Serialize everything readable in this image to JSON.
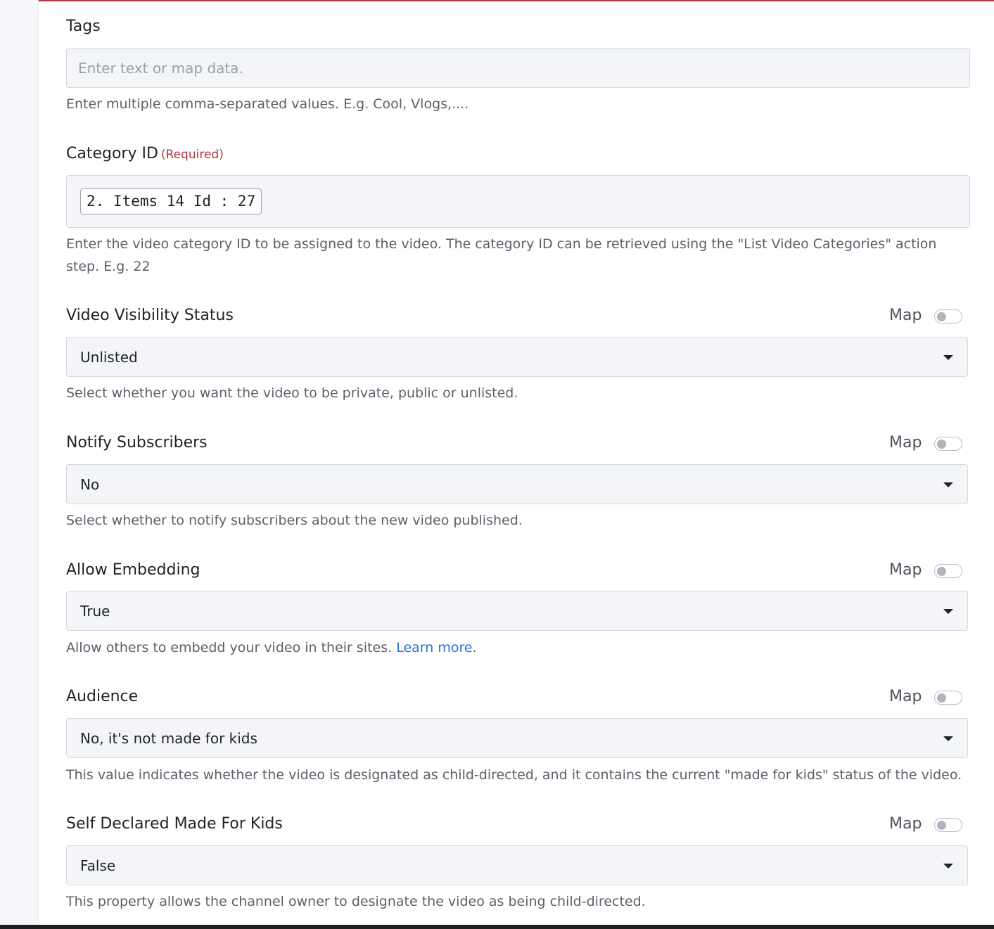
{
  "fields": {
    "tags": {
      "label": "Tags",
      "placeholder": "Enter text or map data.",
      "help": "Enter multiple comma-separated values. E.g. Cool, Vlogs,...."
    },
    "category": {
      "label": "Category ID",
      "required": "(Required)",
      "token": "2. Items 14 Id : 27",
      "help": "Enter the video category ID to be assigned to the video. The category ID can be retrieved using the \"List Video Categories\" action step. E.g. 22"
    },
    "visibility": {
      "label": "Video Visibility Status",
      "map": "Map",
      "map_enabled": false,
      "value": "Unlisted",
      "help": "Select whether you want the video to be private, public or unlisted."
    },
    "notify": {
      "label": "Notify Subscribers",
      "map": "Map",
      "map_enabled": false,
      "value": "No",
      "help": "Select whether to notify subscribers about the new video published."
    },
    "embedding": {
      "label": "Allow Embedding",
      "map": "Map",
      "map_enabled": false,
      "value": "True",
      "help": "Allow others to embedd your video in their sites.",
      "link": "Learn more",
      "after_link": "."
    },
    "audience": {
      "label": "Audience",
      "map": "Map",
      "map_enabled": false,
      "value": "No, it's not made for kids",
      "help": "This value indicates whether the video is designated as child-directed, and it contains the current \"made for kids\" status of the video."
    },
    "self_declared": {
      "label": "Self Declared Made For Kids",
      "map": "Map",
      "map_enabled": false,
      "value": "False",
      "help": "This property allows the channel owner to designate the video as being child-directed."
    }
  },
  "colors": {
    "required": "#b4323d",
    "link": "#2f6fd6",
    "field_bg": "#f3f5f8",
    "top_accent": "#b0353f"
  },
  "icons": {
    "dropdown": "caret-down-icon",
    "map_toggle": "toggle-switch-off"
  }
}
